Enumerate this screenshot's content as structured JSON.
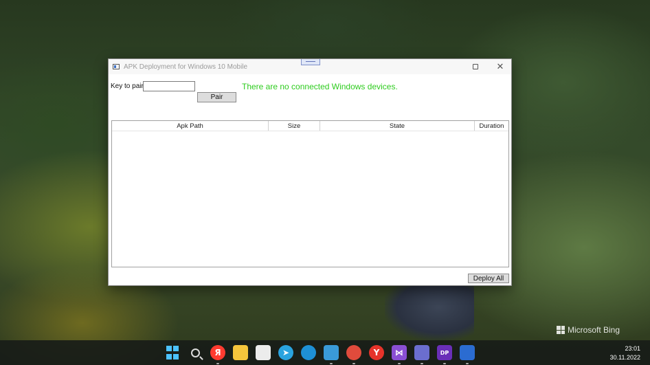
{
  "window": {
    "title": "APK Deployment for Windows 10 Mobile",
    "close_glyph": "✕"
  },
  "pairing": {
    "key_label": "Key to pair",
    "key_value": "",
    "pair_label": "Pair"
  },
  "status": {
    "text": "There are no connected Windows devices.",
    "color": "#2ecc1e"
  },
  "grid": {
    "columns": [
      "Apk Path",
      "Size",
      "State",
      "Duration"
    ],
    "rows": []
  },
  "actions": {
    "deploy_all_label": "Deploy All"
  },
  "desktop": {
    "watermark": "Microsoft Bing"
  },
  "taskbar": {
    "icons": [
      {
        "name": "start-icon"
      },
      {
        "name": "search-icon"
      },
      {
        "name": "yandex-icon",
        "glyph": "Я",
        "color": "#ff3b30"
      },
      {
        "name": "file-explorer-icon",
        "color": "#f5c53c"
      },
      {
        "name": "microsoft-store-icon",
        "color": "#ececec"
      },
      {
        "name": "telegram-icon",
        "glyph": "➤",
        "color": "#2aa3df"
      },
      {
        "name": "edge-icon",
        "color": "#1e90d6"
      },
      {
        "name": "notepad-icon",
        "color": "#3a9ad9"
      },
      {
        "name": "chrome-icon",
        "color": "#e04b3c"
      },
      {
        "name": "yandex-browser-icon",
        "glyph": "Y",
        "color": "#ffffff"
      },
      {
        "name": "visual-studio-icon",
        "glyph": "⋈",
        "color": "#8a4fd4"
      },
      {
        "name": "save-app-icon",
        "color": "#6b6ecf"
      },
      {
        "name": "jetbrains-icon",
        "glyph": "DP",
        "color": "#6a2fb8"
      },
      {
        "name": "running-app-icon",
        "color": "#2b6cd1"
      }
    ],
    "time": "23:01",
    "date": "30.11.2022"
  }
}
